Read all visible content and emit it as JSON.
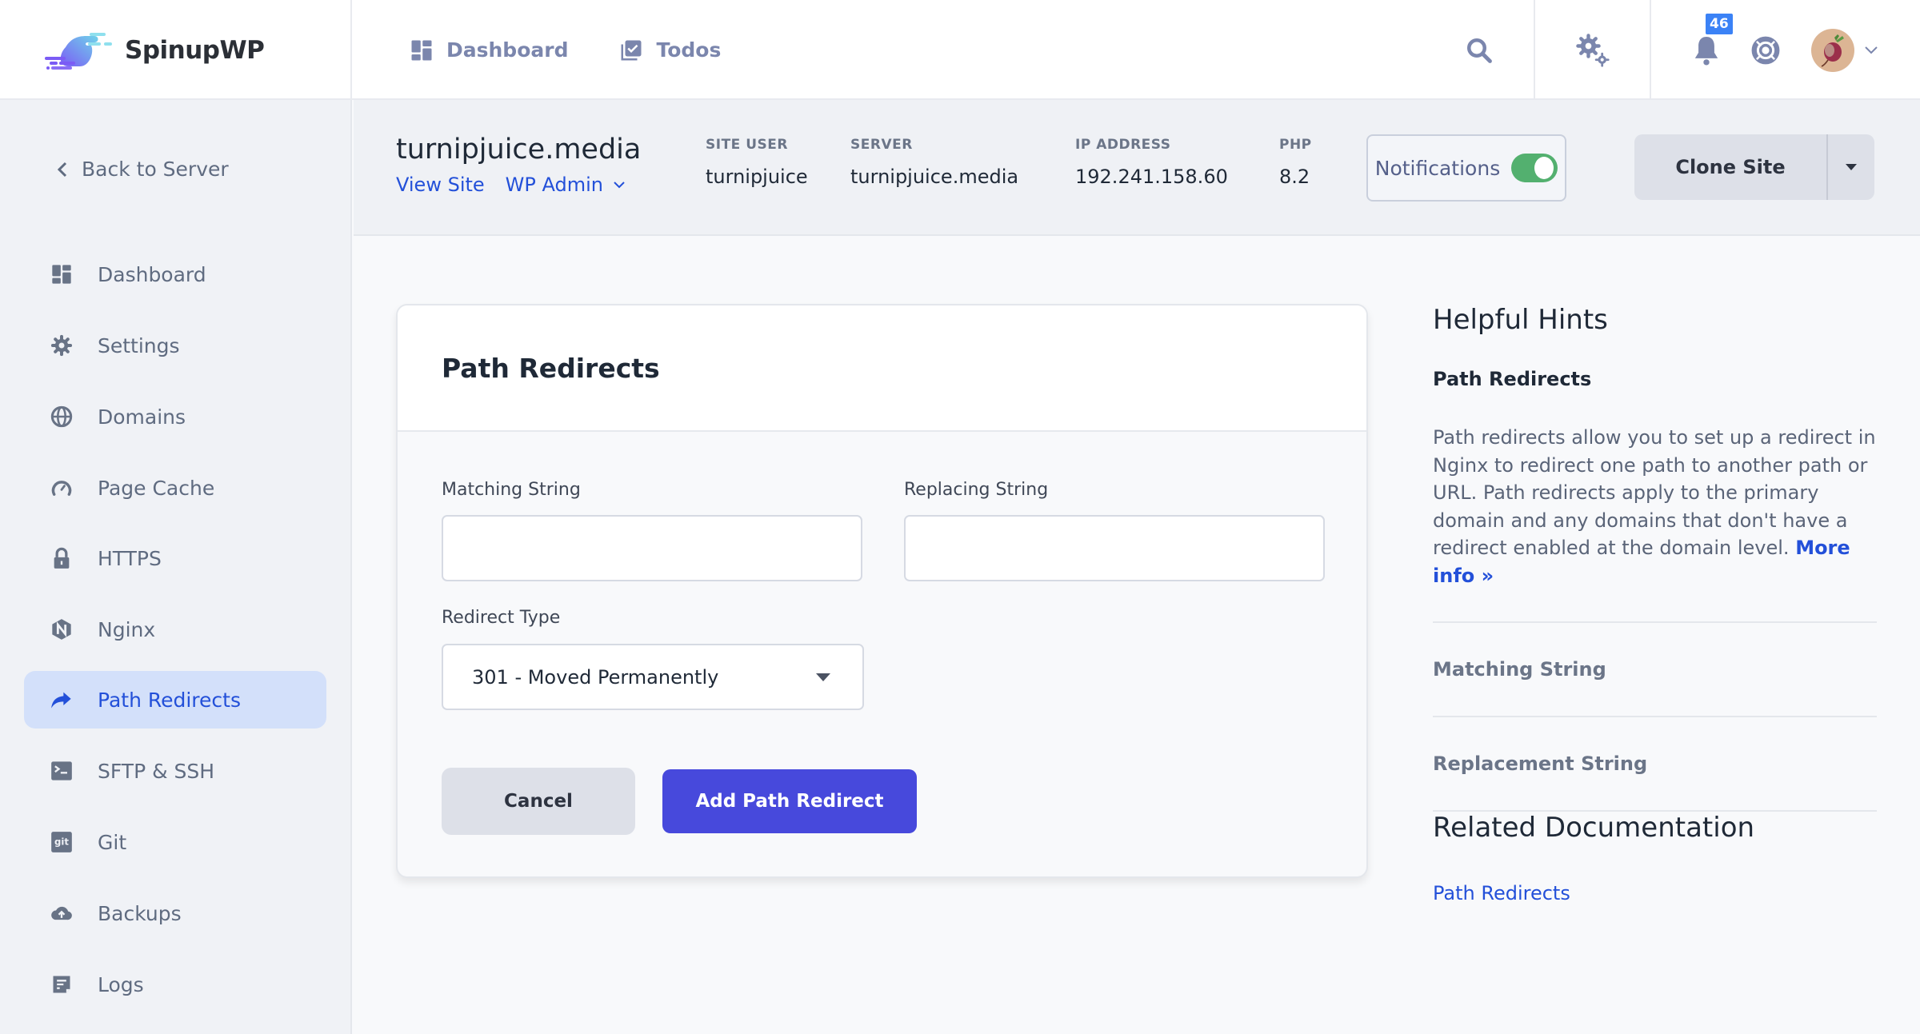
{
  "app": {
    "name": "SpinupWP"
  },
  "topnav": {
    "items": [
      {
        "label": "Dashboard",
        "icon": "dashboard-icon"
      },
      {
        "label": "Todos",
        "icon": "todos-icon"
      }
    ],
    "notifications_count": "46",
    "icons": [
      "search-icon",
      "gears-icon",
      "bell-icon",
      "lifebuoy-icon",
      "avatar",
      "chevron-down-icon"
    ]
  },
  "sidebar": {
    "back_label": "Back to Server",
    "items": [
      {
        "label": "Dashboard",
        "icon": "dashboard-icon",
        "active": false
      },
      {
        "label": "Settings",
        "icon": "gear-icon",
        "active": false
      },
      {
        "label": "Domains",
        "icon": "globe-icon",
        "active": false
      },
      {
        "label": "Page Cache",
        "icon": "gauge-icon",
        "active": false
      },
      {
        "label": "HTTPS",
        "icon": "lock-icon",
        "active": false
      },
      {
        "label": "Nginx",
        "icon": "nginx-icon",
        "active": false
      },
      {
        "label": "Path Redirects",
        "icon": "share-arrow-icon",
        "active": true
      },
      {
        "label": "SFTP & SSH",
        "icon": "terminal-icon",
        "active": false
      },
      {
        "label": "Git",
        "icon": "git-icon",
        "active": false
      },
      {
        "label": "Backups",
        "icon": "cloud-upload-icon",
        "active": false
      },
      {
        "label": "Logs",
        "icon": "logs-icon",
        "active": false
      }
    ]
  },
  "site": {
    "title": "turnipjuice.media",
    "view_site": "View Site",
    "wp_admin": "WP Admin",
    "meta": [
      {
        "label": "SITE USER",
        "value": "turnipjuice"
      },
      {
        "label": "SERVER",
        "value": "turnipjuice.media"
      },
      {
        "label": "IP ADDRESS",
        "value": "192.241.158.60"
      },
      {
        "label": "PHP",
        "value": "8.2"
      }
    ],
    "notifications_label": "Notifications",
    "notifications_enabled": true,
    "clone_label": "Clone Site"
  },
  "form": {
    "title": "Path Redirects",
    "matching_label": "Matching String",
    "matching_value": "",
    "replacing_label": "Replacing String",
    "replacing_value": "",
    "redirect_type_label": "Redirect Type",
    "redirect_type_value": "301 - Moved Permanently",
    "cancel_label": "Cancel",
    "submit_label": "Add Path Redirect"
  },
  "hints": {
    "title": "Helpful Hints",
    "subtitle": "Path Redirects",
    "body": "Path redirects allow you to set up a redirect in Nginx to redirect one path to another path or URL. Path redirects apply to the primary domain and any domains that don't have a redirect enabled at the domain level.",
    "more_info": "More info »",
    "sections": [
      "Matching String",
      "Replacement String"
    ],
    "related_title": "Related Documentation",
    "related_links": [
      "Path Redirects"
    ]
  },
  "colors": {
    "accent": "#2350d9",
    "primary_button": "#4749dc",
    "toggle_on": "#53b06f",
    "badge": "#3b82f6",
    "sidebar_active_bg": "#d3e0fa"
  }
}
